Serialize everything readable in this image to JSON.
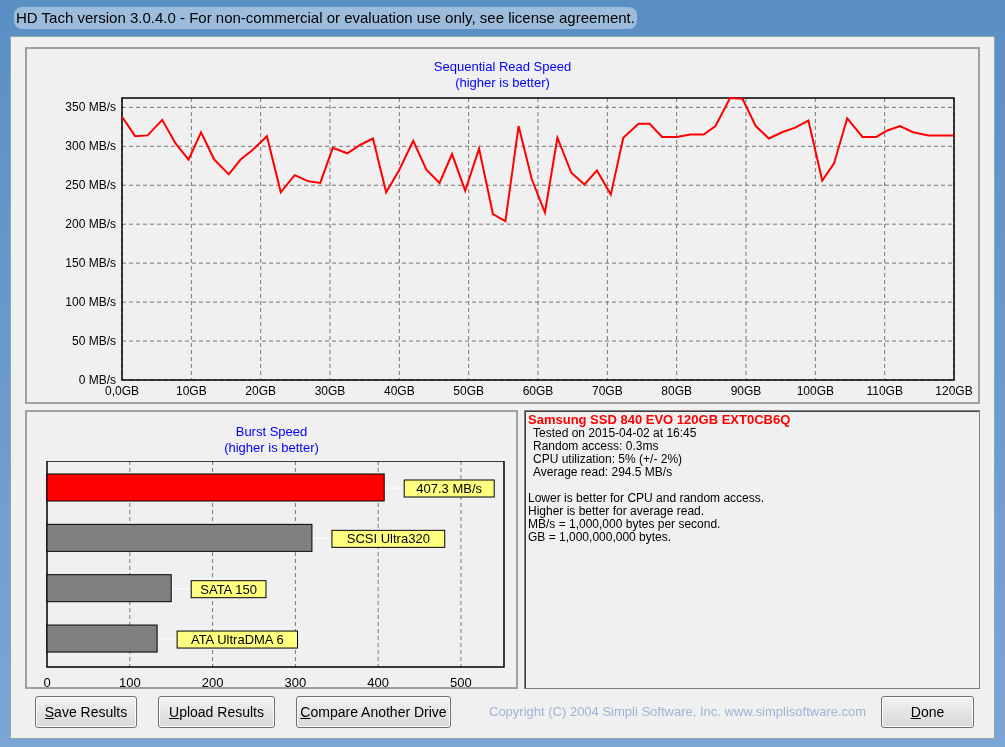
{
  "window": {
    "title": "HD Tach version 3.0.4.0  - For non-commercial or evaluation use only, see license agreement."
  },
  "sequential": {
    "title": "Sequential Read Speed",
    "subtitle": "(higher is better)",
    "chart_data": {
      "type": "line",
      "grid": true,
      "x": [
        0,
        1.9,
        3.7,
        5.8,
        7.7,
        9.6,
        11.4,
        13.3,
        15.4,
        17.1,
        18.8,
        20.9,
        22.9,
        24.9,
        26.9,
        28.6,
        30.4,
        32.5,
        34.4,
        36.2,
        38.1,
        40,
        42,
        43.9,
        45.8,
        47.6,
        49.5,
        51.5,
        53.5,
        55.3,
        57.2,
        59.1,
        61,
        62.8,
        64.8,
        66.7,
        68.5,
        70.5,
        72.3,
        74.5,
        76.1,
        77.9,
        80,
        82,
        83.9,
        85.6,
        87.7,
        89.5,
        91.4,
        93.3,
        95.2,
        97.1,
        99,
        101,
        102.7,
        104.6,
        106.8,
        108.8,
        110.3,
        112.2,
        114.1,
        116.3,
        120
      ],
      "series": [
        {
          "color": "#ff0000",
          "values": [
            338,
            313,
            314,
            334,
            304,
            283,
            318,
            283,
            264,
            283,
            295,
            313,
            241,
            263,
            255,
            253,
            298,
            291,
            302,
            310,
            241,
            270,
            307,
            270,
            253,
            290,
            243,
            297,
            213,
            204,
            326,
            258,
            215,
            311,
            266,
            251,
            269,
            238,
            311,
            329,
            329,
            312,
            312,
            315,
            315,
            326,
            362,
            361,
            326,
            310,
            318,
            324,
            333,
            256,
            278,
            336,
            312,
            312,
            320,
            326,
            318,
            314,
            314
          ]
        }
      ],
      "xlim": [
        0,
        120
      ],
      "ylim": [
        0,
        362
      ],
      "xticks": [
        {
          "value": 0,
          "label": "0,0GB"
        },
        {
          "value": 10,
          "label": "10GB"
        },
        {
          "value": 20,
          "label": "20GB"
        },
        {
          "value": 30,
          "label": "30GB"
        },
        {
          "value": 40,
          "label": "40GB"
        },
        {
          "value": 50,
          "label": "50GB"
        },
        {
          "value": 60,
          "label": "60GB"
        },
        {
          "value": 70,
          "label": "70GB"
        },
        {
          "value": 80,
          "label": "80GB"
        },
        {
          "value": 90,
          "label": "90GB"
        },
        {
          "value": 100,
          "label": "100GB"
        },
        {
          "value": 110,
          "label": "110GB"
        },
        {
          "value": 120,
          "label": "120GB"
        }
      ],
      "yticks": [
        {
          "value": 0,
          "label": "0 MB/s"
        },
        {
          "value": 50,
          "label": "50 MB/s"
        },
        {
          "value": 100,
          "label": "100 MB/s"
        },
        {
          "value": 150,
          "label": "150 MB/s"
        },
        {
          "value": 200,
          "label": "200 MB/s"
        },
        {
          "value": 250,
          "label": "250 MB/s"
        },
        {
          "value": 300,
          "label": "300 MB/s"
        },
        {
          "value": 350,
          "label": "350 MB/s"
        }
      ]
    }
  },
  "burst": {
    "title": "Burst Speed",
    "subtitle": "(higher is better)",
    "chart_data": {
      "type": "bar",
      "orientation": "horizontal",
      "grid": true,
      "categories": [
        "407.3 MB/s",
        "SCSI Ultra320",
        "SATA 150",
        "ATA UltraDMA 6"
      ],
      "series": [
        {
          "color": "#ff0000",
          "values": [
            407.3,
            null,
            null,
            null
          ]
        },
        {
          "color": "#808080",
          "values": [
            null,
            320,
            150,
            133
          ]
        }
      ],
      "xlim": [
        0,
        552
      ],
      "xticks": [
        0,
        100,
        200,
        300,
        400,
        500
      ]
    }
  },
  "info": {
    "drive": "Samsung SSD 840 EVO 120GB EXT0CB6Q",
    "details": [
      "Tested on 2015-04-02 at 16:45",
      "Random access: 0.3ms",
      "CPU utilization: 5% (+/- 2%)",
      "Average read: 294.5 MB/s"
    ],
    "notes": [
      "Lower is better for CPU and random access.",
      "Higher is better for average read.",
      "MB/s = 1,000,000 bytes per second.",
      "GB = 1,000,000,000 bytes."
    ]
  },
  "buttons": [
    "Save Results",
    "Upload Results",
    "Compare Another Drive"
  ],
  "copyright": "Copyright (C) 2004 Simpli Software, Inc. www.simplisoftware.com",
  "done_button": "Done"
}
